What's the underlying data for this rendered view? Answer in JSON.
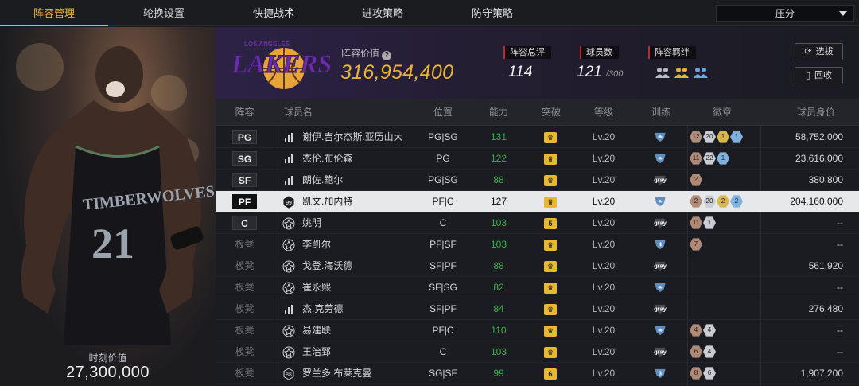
{
  "tabs": [
    "阵容管理",
    "轮换设置",
    "快捷战术",
    "进攻策略",
    "防守策略"
  ],
  "sort": {
    "selected": "压分"
  },
  "left_panel": {
    "value_label": "时刻价值",
    "value": "27,300,000"
  },
  "team": {
    "logo_text": "LAKERS",
    "logo_subtext": "LOS ANGELES",
    "value_label": "阵容价值",
    "value": "316,954,400",
    "total_rating_label": "阵容总评",
    "total_rating": "114",
    "player_count_label": "球员数",
    "player_count": "121",
    "player_cap": "/300",
    "chemistry_label": "阵容羁绊",
    "chemistry_icons": [
      "chemistry-gray-icon",
      "chemistry-gold-icon",
      "chemistry-blue-icon"
    ],
    "btn_select": "选拔",
    "btn_recycle": "回收"
  },
  "columns": [
    "阵容",
    "球员名",
    "位置",
    "能力",
    "突破",
    "等级",
    "训练",
    "徽章",
    "球员身价"
  ],
  "colors": {
    "accent": "#e8b43a",
    "ability": "#3fae4a",
    "red_marker": "#c8222b"
  },
  "rows": [
    {
      "slot": "PG",
      "starter": true,
      "rank": "bars",
      "name": "谢伊.吉尔杰斯.亚历山大",
      "pos": "PG|SG",
      "ability": "131",
      "crown": "",
      "level": "Lv.20",
      "train": "blue",
      "badges": [
        [
          "br",
          "12"
        ],
        [
          "si",
          "20"
        ],
        [
          "go",
          "1"
        ],
        [
          "bl",
          "1"
        ]
      ],
      "price": "58,752,000"
    },
    {
      "slot": "SG",
      "starter": true,
      "rank": "bars",
      "name": "杰伦.布伦森",
      "pos": "PG",
      "ability": "122",
      "crown": "",
      "level": "Lv.20",
      "train": "blue",
      "badges": [
        [
          "br",
          "11"
        ],
        [
          "si",
          "22"
        ],
        [
          "bl",
          "1"
        ]
      ],
      "price": "23,616,000"
    },
    {
      "slot": "SF",
      "starter": true,
      "rank": "bars",
      "name": "朗佐.鲍尔",
      "pos": "PG|SG",
      "ability": "88",
      "crown": "",
      "level": "Lv.20",
      "train": "gray",
      "badges": [
        [
          "br",
          "2"
        ]
      ],
      "price": "380,800"
    },
    {
      "slot": "PF",
      "starter": true,
      "selected": true,
      "rank": "99",
      "name": "凯文.加内特",
      "pos": "PF|C",
      "ability": "127",
      "crown": "",
      "level": "Lv.20",
      "train": "blue",
      "badges": [
        [
          "br",
          "2"
        ],
        [
          "si",
          "20"
        ],
        [
          "go",
          "2"
        ],
        [
          "bl",
          "2"
        ]
      ],
      "price": "204,160,000"
    },
    {
      "slot": "C",
      "starter": true,
      "rank": "star",
      "name": "姚明",
      "pos": "C",
      "ability": "103",
      "crown": "5",
      "level": "Lv.20",
      "train": "gray",
      "badges": [
        [
          "br",
          "11"
        ],
        [
          "si",
          "1"
        ]
      ],
      "price": "--"
    },
    {
      "slot": "板凳",
      "starter": false,
      "rank": "star",
      "name": "李凯尔",
      "pos": "PF|SF",
      "ability": "103",
      "crown": "",
      "level": "Lv.20",
      "train": "blue4",
      "badges": [
        [
          "br",
          "7"
        ]
      ],
      "price": "--"
    },
    {
      "slot": "板凳",
      "starter": false,
      "rank": "star",
      "name": "戈登.海沃德",
      "pos": "SF|PF",
      "ability": "88",
      "crown": "",
      "level": "Lv.20",
      "train": "gray",
      "badges": [],
      "price": "561,920"
    },
    {
      "slot": "板凳",
      "starter": false,
      "rank": "star",
      "name": "崔永熙",
      "pos": "SF|SG",
      "ability": "82",
      "crown": "",
      "level": "Lv.20",
      "train": "blue",
      "badges": [],
      "price": "--"
    },
    {
      "slot": "板凳",
      "starter": false,
      "rank": "bars",
      "name": "杰.克劳德",
      "pos": "SF|PF",
      "ability": "84",
      "crown": "",
      "level": "Lv.20",
      "train": "gray",
      "badges": [],
      "price": "276,480"
    },
    {
      "slot": "板凳",
      "starter": false,
      "rank": "star",
      "name": "易建联",
      "pos": "PF|C",
      "ability": "110",
      "crown": "",
      "level": "Lv.20",
      "train": "blue",
      "badges": [
        [
          "br",
          "4"
        ],
        [
          "si",
          "4"
        ]
      ],
      "price": "--"
    },
    {
      "slot": "板凳",
      "starter": false,
      "rank": "star",
      "name": "王治郅",
      "pos": "C",
      "ability": "103",
      "crown": "",
      "level": "Lv.20",
      "train": "gray",
      "badges": [
        [
          "br",
          "6"
        ],
        [
          "si",
          "4"
        ]
      ],
      "price": "--"
    },
    {
      "slot": "板凳",
      "starter": false,
      "rank": "88",
      "name": "罗兰多.布莱克曼",
      "pos": "SG|SF",
      "ability": "99",
      "crown": "6",
      "level": "Lv.20",
      "train": "blue3",
      "badges": [
        [
          "br",
          "8"
        ],
        [
          "si",
          "6"
        ]
      ],
      "price": "1,907,200"
    }
  ]
}
